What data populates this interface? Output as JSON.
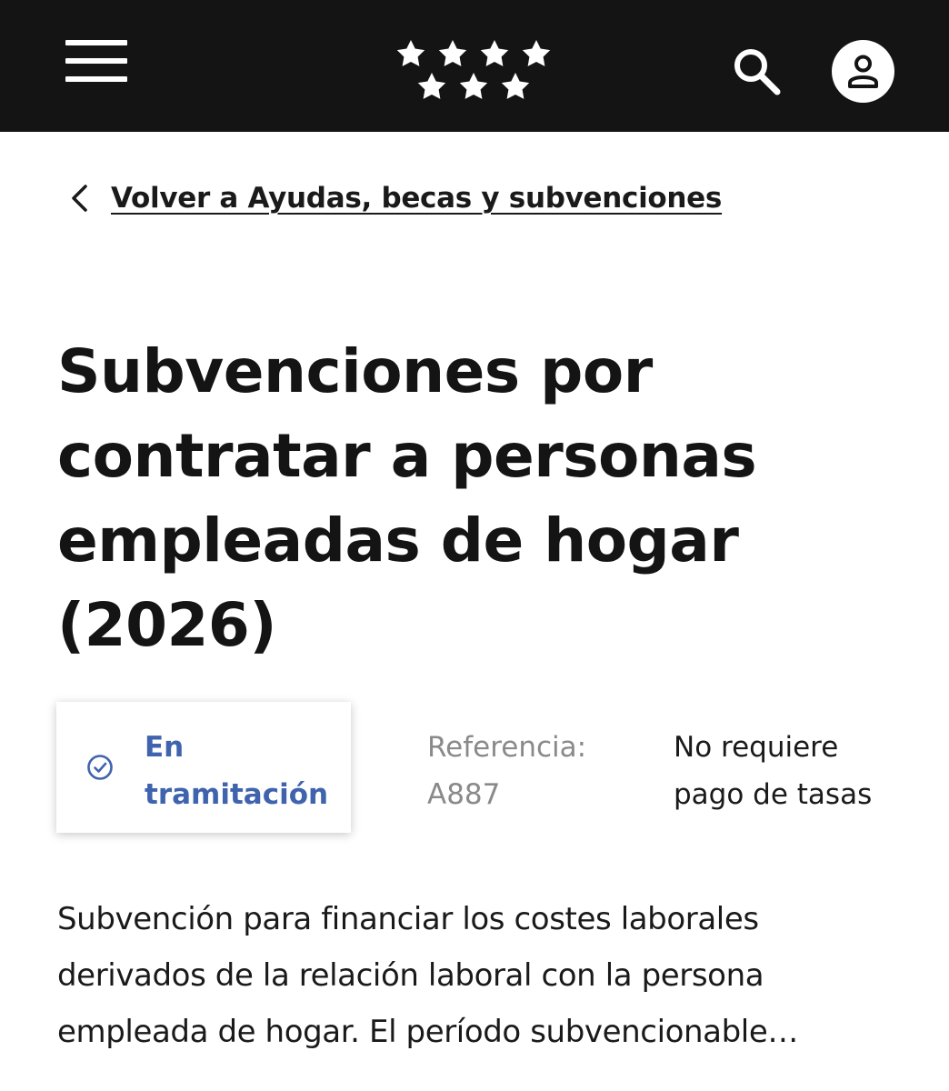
{
  "header": {
    "menu_icon": "hamburger-menu-icon",
    "logo_icon": "seven-stars-logo-icon",
    "search_icon": "search-icon",
    "user_icon": "user-account-icon",
    "background_color": "#141414"
  },
  "back_link": {
    "icon": "chevron-left-icon",
    "label": "Volver a Ayudas, becas y subvenciones"
  },
  "page": {
    "title_line_1": "Subvenciones por",
    "title_line_2": "contratar a personas",
    "title_line_3": "empleadas de hogar",
    "title_line_4": "(2026)"
  },
  "status": {
    "icon": "check-circle-icon",
    "label_line_1": "En",
    "label_line_2": "tramitación",
    "color": "#3f63ad"
  },
  "reference": {
    "label": "Referencia:",
    "value": "A887"
  },
  "fees": {
    "line_1": "No requiere",
    "line_2": "pago de tasas"
  },
  "description": {
    "line_1": "Subvención para financiar los costes laborales",
    "line_2": "derivados de la relación laboral con la persona",
    "line_3": "empleada de hogar. El período subvencionable…"
  }
}
